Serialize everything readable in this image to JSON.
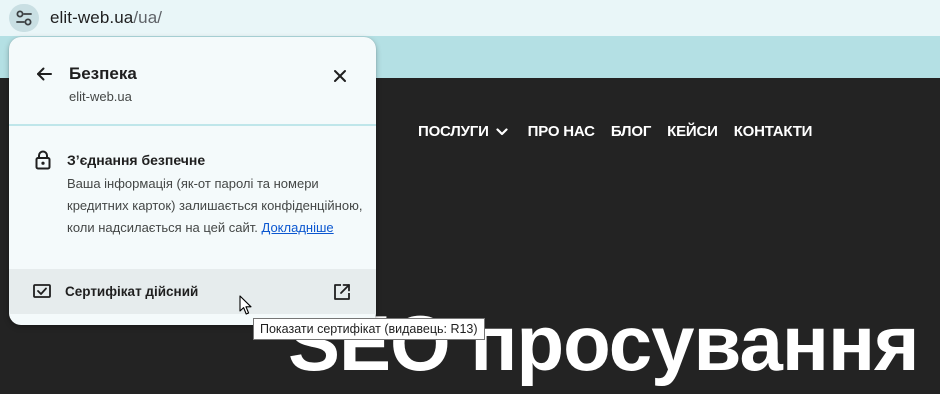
{
  "browser": {
    "url_host": "elit-web.ua",
    "url_path": "/ua/",
    "site_info_icon": "tune-icon"
  },
  "site": {
    "nav": [
      {
        "label": "ПОСЛУГИ",
        "has_dropdown": true
      },
      {
        "label": "ПРО НАС"
      },
      {
        "label": "БЛОГ"
      },
      {
        "label": "КЕЙСИ"
      },
      {
        "label": "КОНТАКТИ"
      }
    ],
    "hero": "SEO просування"
  },
  "popup": {
    "title": "Безпека",
    "subtitle": "elit-web.ua",
    "connection": {
      "title": "З’єднання безпечне",
      "description": "Ваша інформація (як-от паролі та номери кредитних карток) залишається конфіденційною, коли надсилається на цей сайт.",
      "more_link": "Докладніше"
    },
    "certificate": {
      "label": "Сертифікат дійсний"
    }
  },
  "tooltip": "Показати сертифікат (видавець: R13)",
  "colors": {
    "accent_line": "#bfe6ea",
    "page_bg": "#232323",
    "link": "#0b57d0"
  }
}
